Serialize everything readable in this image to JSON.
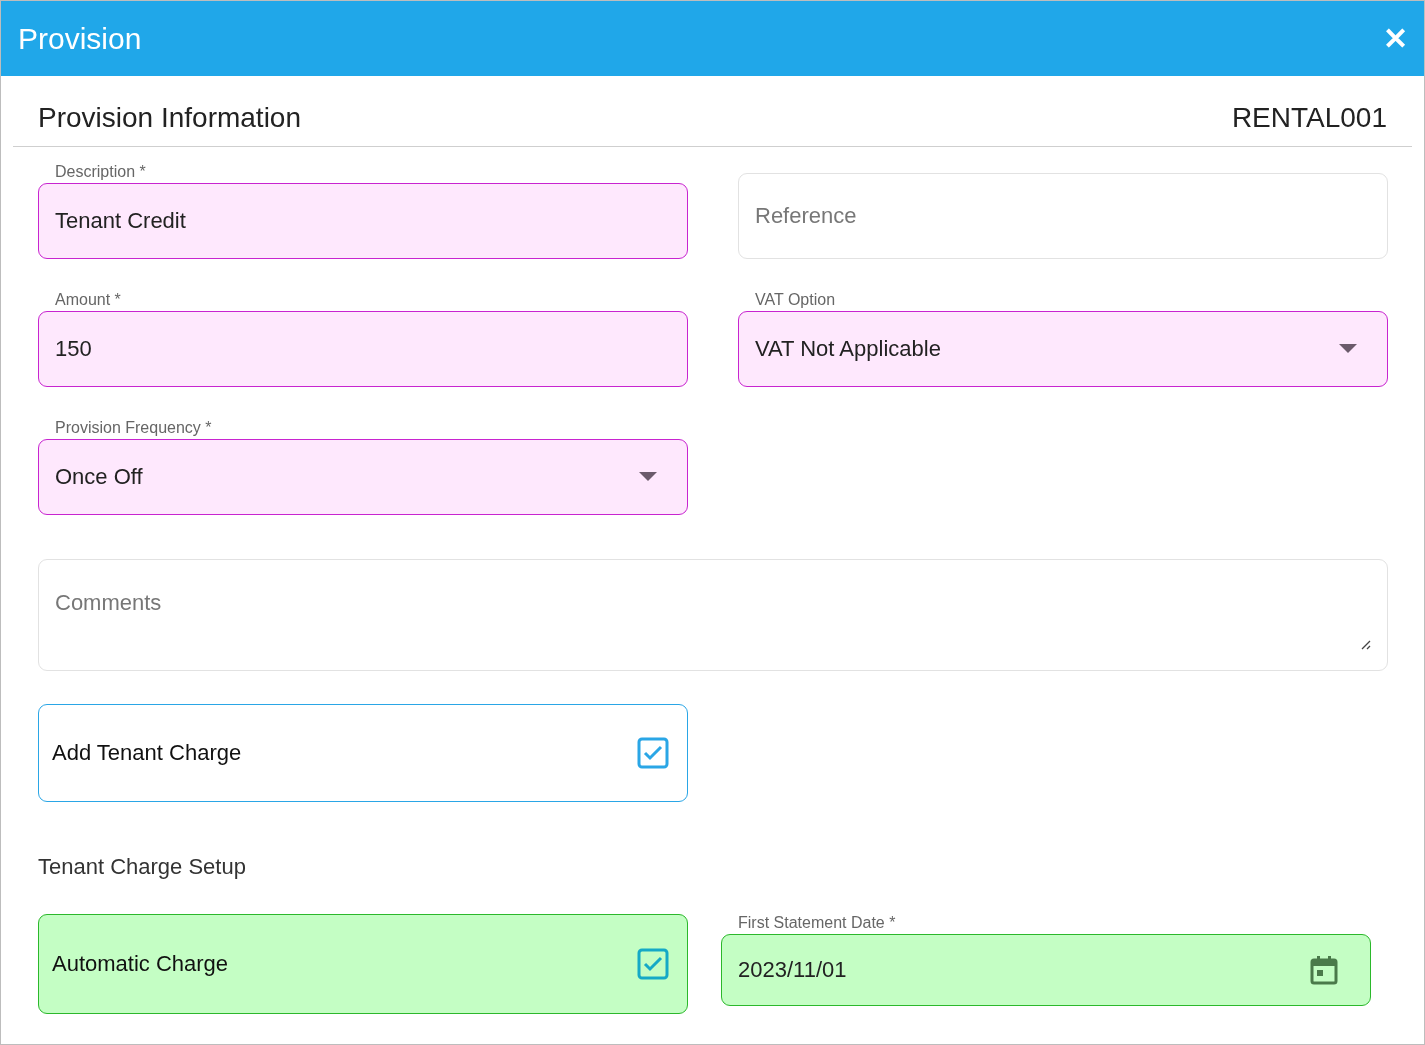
{
  "window": {
    "title": "Provision",
    "close": "✕"
  },
  "header": {
    "title": "Provision Information",
    "code": "RENTAL001"
  },
  "fields": [
    {
      "kind": "text",
      "label": "Description *",
      "value": "Tenant Credit",
      "color": "#fee8fd"
    },
    {
      "kind": "text",
      "placeholder": "Reference"
    },
    {
      "kind": "text",
      "label": "Amount *",
      "value": "150",
      "color": "#fee8fd"
    },
    {
      "kind": "select",
      "label": "VAT Option",
      "value": "VAT Not Applicable",
      "color": "#fee8fd"
    },
    {
      "kind": "select",
      "label": "Provision Frequency *",
      "value": "Once Off",
      "color": "#fee8fd"
    },
    {
      "kind": "textarea",
      "placeholder": "Comments"
    }
  ],
  "add_tenant_charge": {
    "label": "Add Tenant Charge",
    "checked": true
  },
  "tenant_charge_setup": {
    "title": "Tenant Charge Setup",
    "automatic_charge": {
      "label": "Automatic Charge",
      "checked": true,
      "color": "#c4fec4"
    },
    "first_statement_date": {
      "kind": "date",
      "label": "First Statement Date *",
      "value": "2023/11/01",
      "color": "#c4fec4"
    }
  }
}
